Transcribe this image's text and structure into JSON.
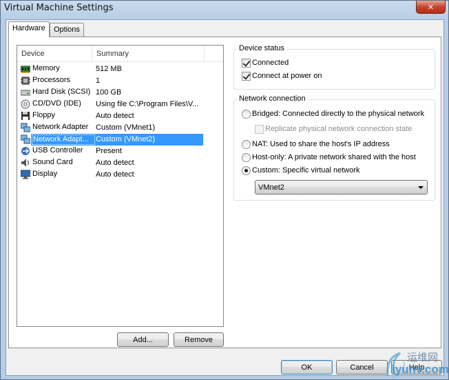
{
  "window": {
    "title": "Virtual Machine Settings",
    "close_glyph": "✕"
  },
  "tabs": [
    {
      "label": "Hardware",
      "active": true
    },
    {
      "label": "Options",
      "active": false
    }
  ],
  "device_list": {
    "columns": {
      "device": "Device",
      "summary": "Summary"
    },
    "rows": [
      {
        "icon": "memory-icon",
        "device": "Memory",
        "summary": "512 MB"
      },
      {
        "icon": "processor-icon",
        "device": "Processors",
        "summary": "1"
      },
      {
        "icon": "hard-disk-icon",
        "device": "Hard Disk (SCSI)",
        "summary": "100 GB"
      },
      {
        "icon": "cd-dvd-icon",
        "device": "CD/DVD (IDE)",
        "summary": "Using file C:\\Program Files\\V..."
      },
      {
        "icon": "floppy-icon",
        "device": "Floppy",
        "summary": "Auto detect"
      },
      {
        "icon": "network-adapter-icon",
        "device": "Network Adapter",
        "summary": "Custom (VMnet1)"
      },
      {
        "icon": "network-adapter-icon",
        "device": "Network Adapt...",
        "summary": "Custom (VMnet2)",
        "selected": true
      },
      {
        "icon": "usb-icon",
        "device": "USB Controller",
        "summary": "Present"
      },
      {
        "icon": "sound-card-icon",
        "device": "Sound Card",
        "summary": "Auto detect"
      },
      {
        "icon": "display-icon",
        "device": "Display",
        "summary": "Auto detect"
      }
    ]
  },
  "buttons": {
    "add": "Add...",
    "remove": "Remove",
    "ok": "OK",
    "cancel": "Cancel",
    "help": "Help"
  },
  "device_status": {
    "title": "Device status",
    "connected": {
      "label": "Connected",
      "checked": true
    },
    "connect_at_power_on": {
      "label": "Connect at power on",
      "checked": true
    }
  },
  "network_connection": {
    "title": "Network connection",
    "bridged": {
      "label": "Bridged: Connected directly to the physical network",
      "selected": false
    },
    "replicate": {
      "label": "Replicate physical network connection state",
      "checked": false,
      "disabled": true
    },
    "nat": {
      "label": "NAT: Used to share the host's IP address",
      "selected": false
    },
    "host_only": {
      "label": "Host-only: A private network shared with the host",
      "selected": false
    },
    "custom": {
      "label": "Custom: Specific virtual network",
      "selected": true
    },
    "custom_network": "VMnet2"
  },
  "watermark": {
    "text_cn": "运维网",
    "text_en": "iyunv.com"
  },
  "colors": {
    "selection": "#3399ff",
    "title_bar": "#b6cde6",
    "close_button": "#c7432c"
  }
}
